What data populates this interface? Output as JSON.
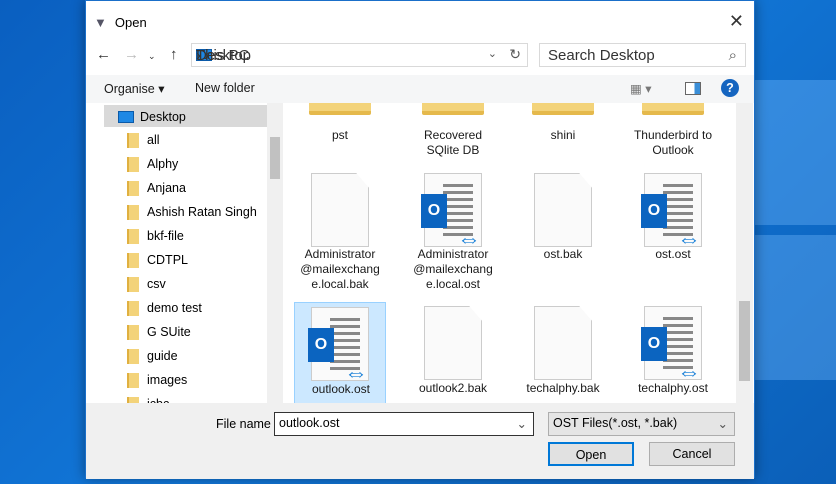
{
  "dialog": {
    "title": "Open"
  },
  "address": {
    "path": [
      "This PC",
      "Desktop"
    ],
    "search_placeholder": "Search Desktop"
  },
  "toolbar": {
    "organise": "Organise ▾",
    "new_folder": "New folder"
  },
  "sidebar": {
    "items": [
      "Desktop",
      "all",
      "Alphy",
      "Anjana",
      "Ashish Ratan Singh",
      "bkf-file",
      "CDTPL",
      "csv",
      "demo test",
      "G SUite",
      "guide",
      "images",
      "icbc"
    ]
  },
  "files": [
    {
      "name": "pst",
      "type": "folder"
    },
    {
      "name": "Recovered SQlite DB",
      "type": "folder"
    },
    {
      "name": "shini",
      "type": "folder"
    },
    {
      "name": "Thunderbird to Outlook",
      "type": "folder"
    },
    {
      "name": "Administrator @mailexchang e.local.bak",
      "type": "blank"
    },
    {
      "name": "Administrator @mailexchang e.local.ost",
      "type": "ost"
    },
    {
      "name": "ost.bak",
      "type": "blank"
    },
    {
      "name": "ost.ost",
      "type": "ost"
    },
    {
      "name": "outlook.ost",
      "type": "ost",
      "selected": true
    },
    {
      "name": "outlook2.bak",
      "type": "blank"
    },
    {
      "name": "techalphy.bak",
      "type": "blank"
    },
    {
      "name": "techalphy.ost",
      "type": "ost"
    }
  ],
  "footer": {
    "file_name_label": "File name",
    "file_name_value": "outlook.ost",
    "file_type": "OST Files(*.ost, *.bak)",
    "open": "Open",
    "cancel": "Cancel"
  }
}
